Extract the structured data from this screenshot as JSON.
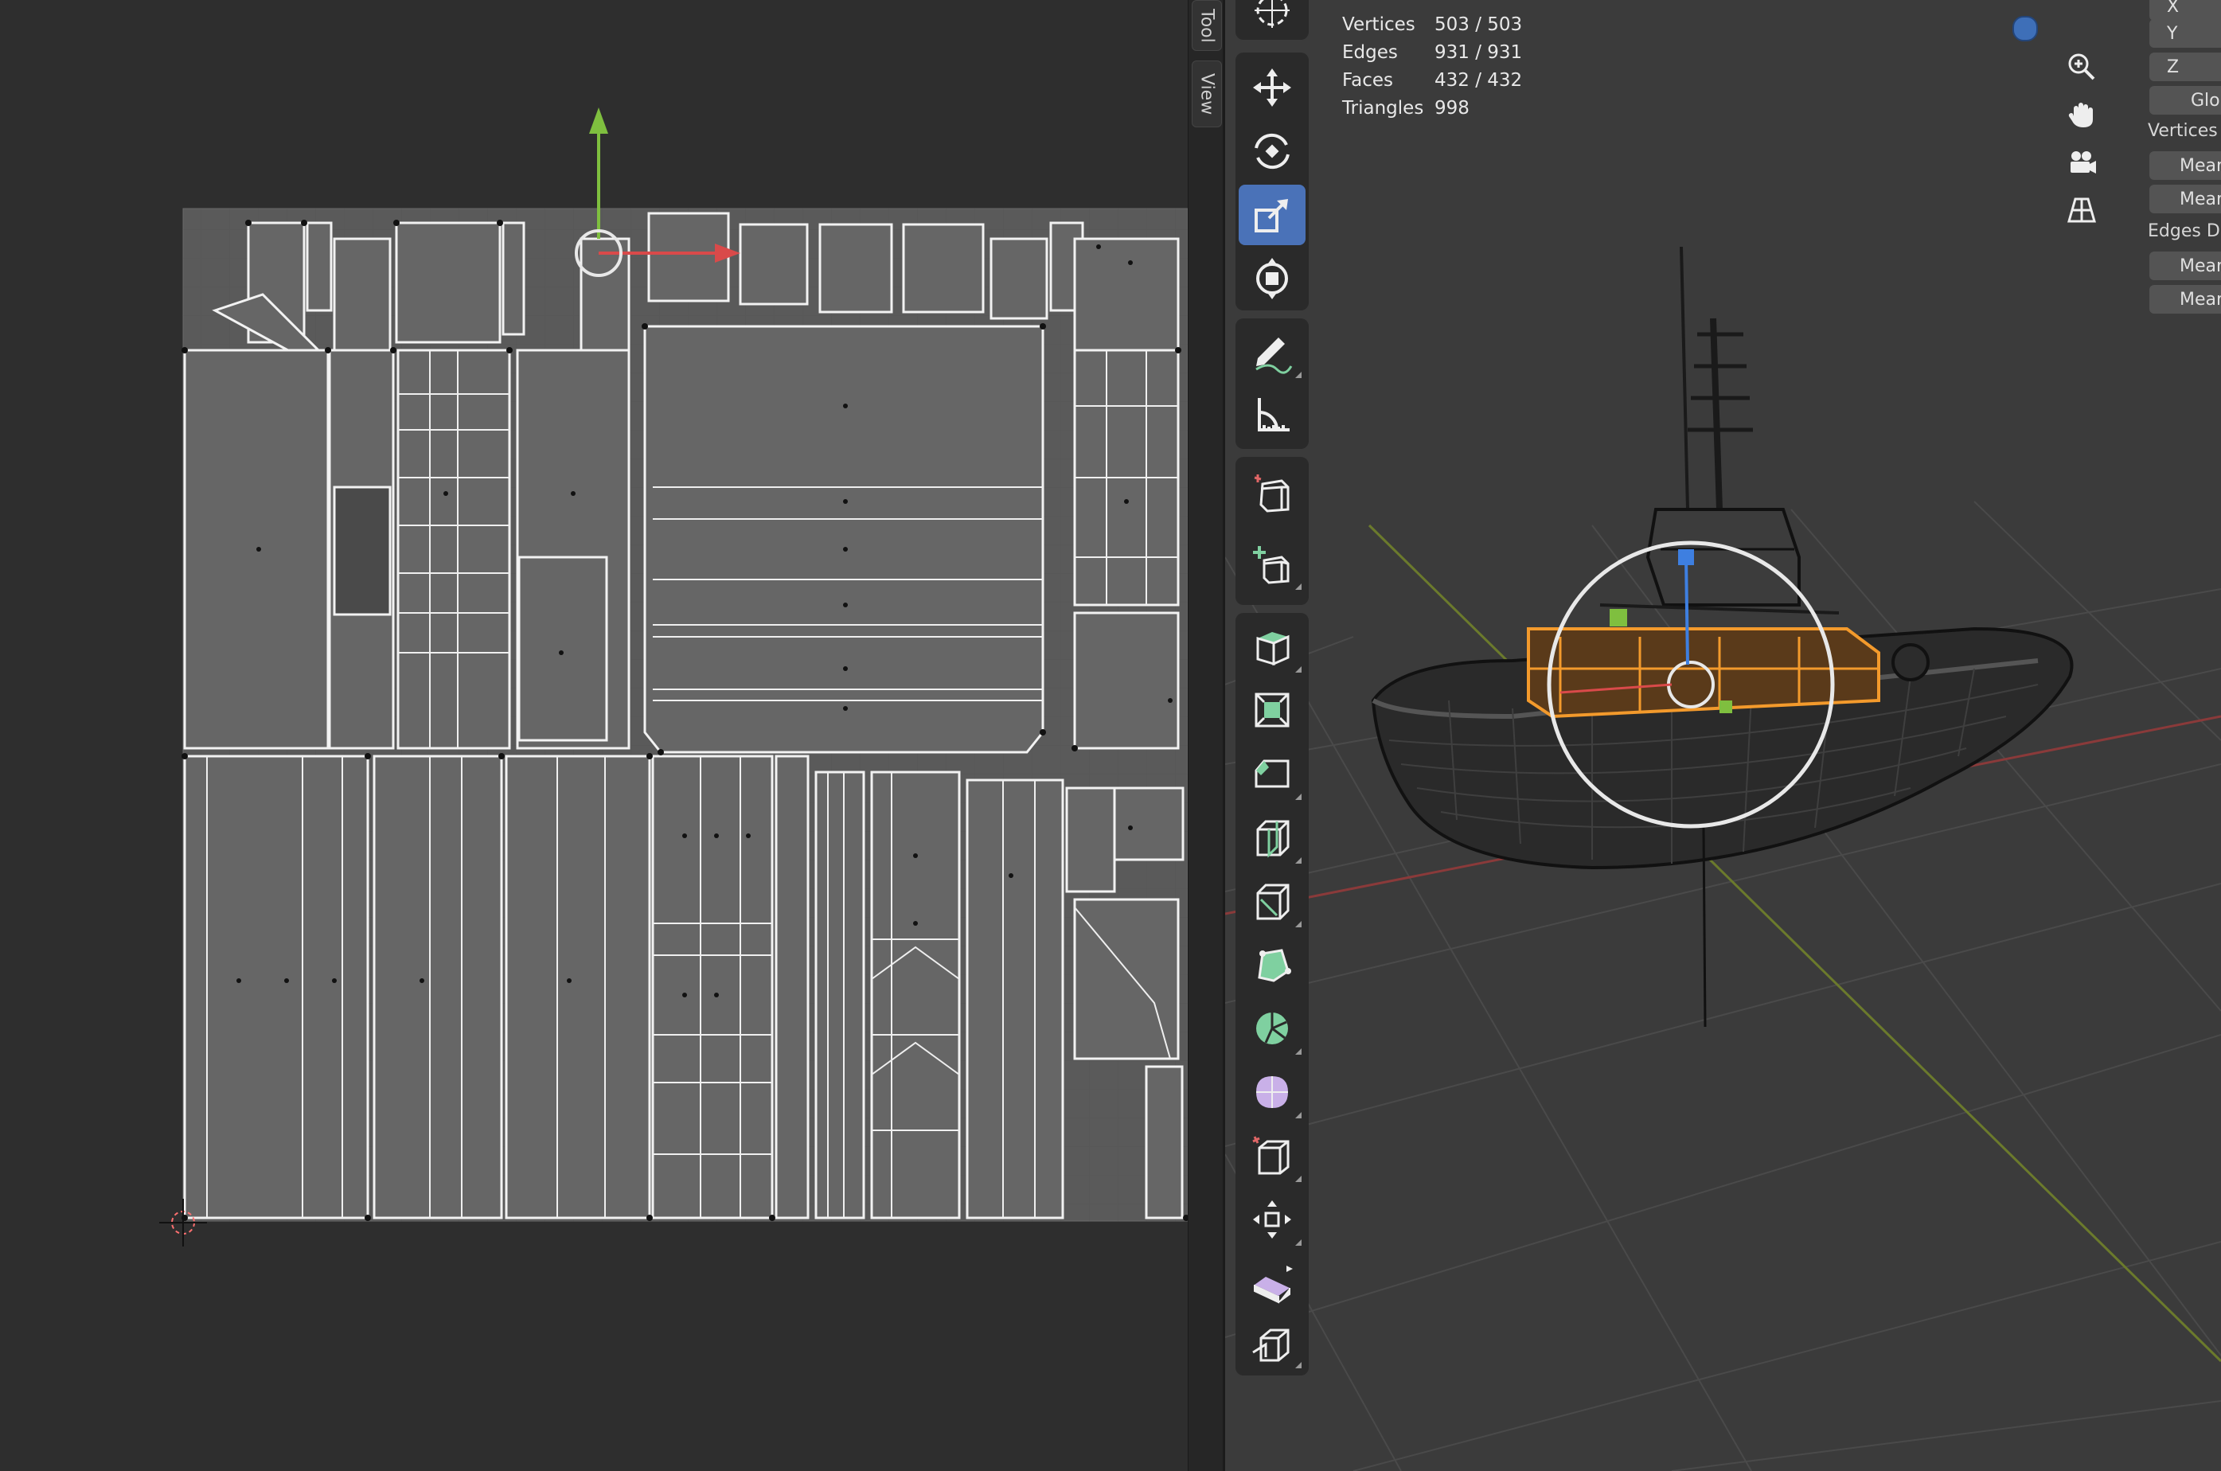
{
  "sidebar_tabs": {
    "tool": "Tool",
    "view": "View"
  },
  "stats": [
    {
      "label": "Vertices",
      "value": "503 / 503"
    },
    {
      "label": "Edges",
      "value": "931 / 931"
    },
    {
      "label": "Faces",
      "value": "432 / 432"
    },
    {
      "label": "Triangles",
      "value": "998"
    }
  ],
  "npanel": {
    "axis_x": "X",
    "axis_y": "Y",
    "axis_z": "Z",
    "orientation": "Glob",
    "vertices_label": "Vertices",
    "vertices_mean_1": "Mean",
    "vertices_mean_2": "Mean",
    "edges_label": "Edges Da",
    "edges_mean_1": "Mean",
    "edges_mean_2": "Mean"
  },
  "tools": [
    {
      "name": "cursor-tool-icon"
    },
    {
      "name": "move-tool-icon"
    },
    {
      "name": "rotate-tool-icon"
    },
    {
      "name": "scale-tool-icon",
      "active": true
    },
    {
      "name": "transform-tool-icon"
    },
    {
      "name": "annotate-tool-icon"
    },
    {
      "name": "measure-tool-icon"
    },
    {
      "name": "add-cube-tool-icon"
    },
    {
      "name": "extrude-region-tool-icon"
    },
    {
      "name": "inset-faces-tool-icon"
    },
    {
      "name": "bevel-tool-icon"
    },
    {
      "name": "loop-cut-tool-icon"
    },
    {
      "name": "knife-tool-icon"
    },
    {
      "name": "poly-build-tool-icon"
    },
    {
      "name": "spin-tool-icon"
    },
    {
      "name": "smooth-tool-icon"
    },
    {
      "name": "edge-slide-tool-icon"
    },
    {
      "name": "shrink-fatten-tool-icon"
    },
    {
      "name": "shear-tool-icon"
    },
    {
      "name": "rip-region-tool-icon"
    }
  ],
  "colors": {
    "active_tool": "#4a72b8",
    "gizmo_x": "#d94a4a",
    "gizmo_y": "#7fbf3f",
    "gizmo_z": "#3e7fe0",
    "selection": "#f39a2c"
  }
}
